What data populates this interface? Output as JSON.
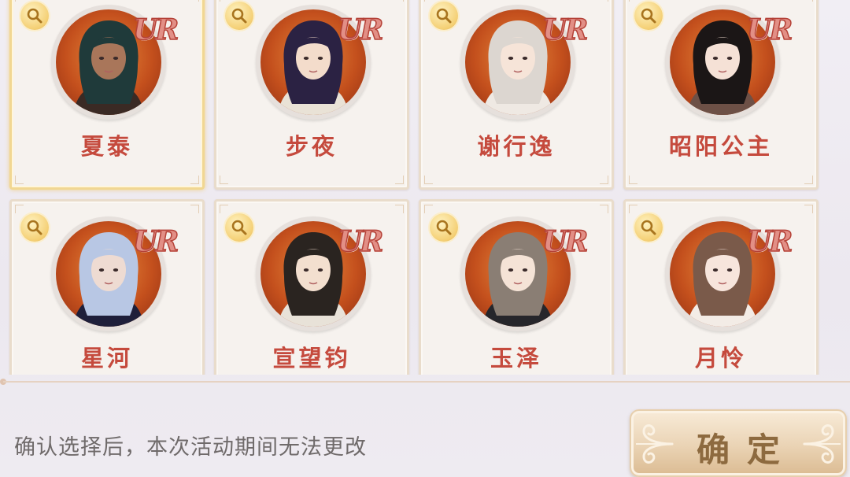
{
  "characters": [
    {
      "name": "夏泰",
      "rarity": "UR",
      "selected": true,
      "hair": "#1f3a3a",
      "skin": "#a9765a",
      "outfit": "#3a2a24"
    },
    {
      "name": "步夜",
      "rarity": "UR",
      "selected": false,
      "hair": "#2b2243",
      "skin": "#f3dccb",
      "outfit": "#e9e2d6"
    },
    {
      "name": "谢行逸",
      "rarity": "UR",
      "selected": false,
      "hair": "#dcd6d0",
      "skin": "#f6e4d8",
      "outfit": "#efe9e3"
    },
    {
      "name": "昭阳公主",
      "rarity": "UR",
      "selected": false,
      "hair": "#1b1616",
      "skin": "#f5e1d6",
      "outfit": "#6d5046"
    },
    {
      "name": "星河",
      "rarity": "UR",
      "selected": false,
      "hair": "#b8c7e4",
      "skin": "#eedbd2",
      "outfit": "#1e1f3a"
    },
    {
      "name": "宣望钧",
      "rarity": "UR",
      "selected": false,
      "hair": "#2a2420",
      "skin": "#f3dfcf",
      "outfit": "#e8e2d8"
    },
    {
      "name": "玉泽",
      "rarity": "UR",
      "selected": false,
      "hair": "#8a7e74",
      "skin": "#f5e3d6",
      "outfit": "#26262b"
    },
    {
      "name": "月怜",
      "rarity": "UR",
      "selected": false,
      "hair": "#7a5a4a",
      "skin": "#f7e5dc",
      "outfit": "#f3ece6"
    }
  ],
  "footer": {
    "notice": "确认选择后，本次活动期间无法更改",
    "confirm_label": "确定"
  },
  "colors": {
    "name_red": "#c54a3d",
    "ur_pink": "#e28f86",
    "selected_border": "#f1d792"
  },
  "icons": {
    "inspect": "magnifier-icon"
  }
}
